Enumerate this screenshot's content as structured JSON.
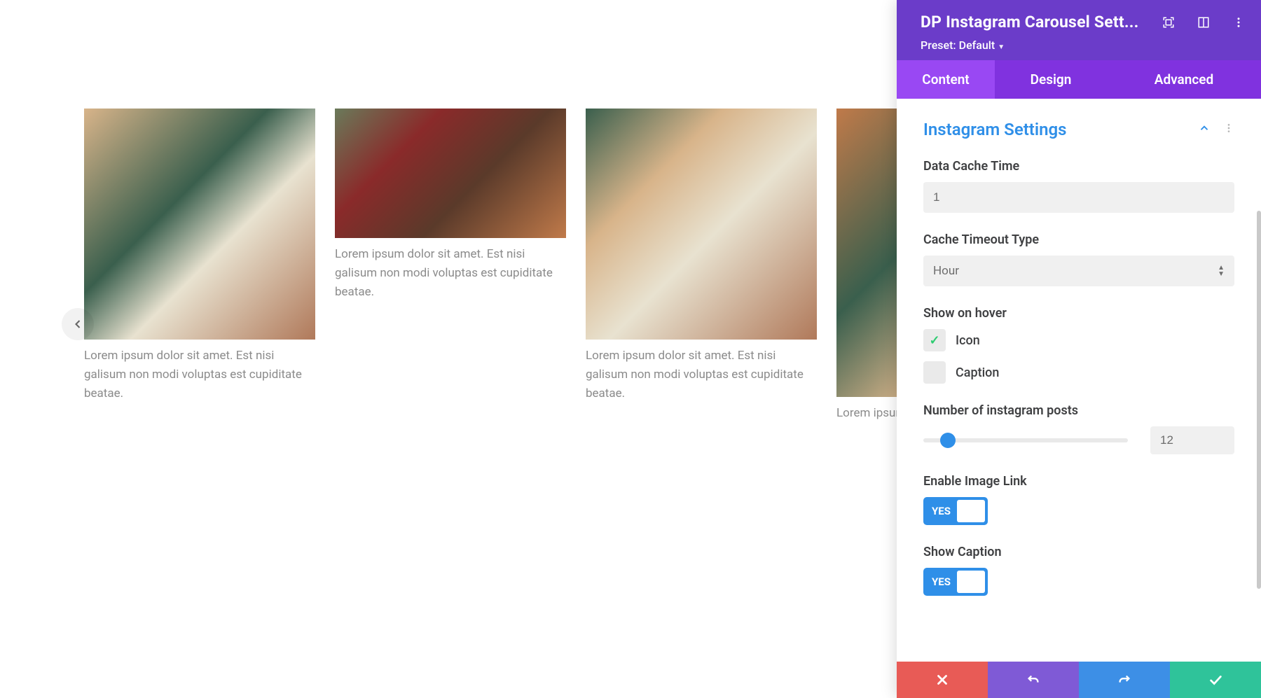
{
  "carousel": {
    "nav_prev_icon": "chevron-left",
    "items": [
      {
        "image_style": "ph1",
        "height_class": "img-tall",
        "caption": "Lorem ipsum dolor sit amet. Est nisi galisum non modi voluptas est cupiditate beatae."
      },
      {
        "image_style": "ph2",
        "height_class": "img-short",
        "caption": "Lorem ipsum dolor sit amet. Est nisi galisum non modi voluptas est cupiditate beatae."
      },
      {
        "image_style": "ph3",
        "height_class": "img-tall",
        "caption": "Lorem ipsum dolor sit amet. Est nisi galisum non modi voluptas est cupiditate beatae."
      },
      {
        "image_style": "ph4",
        "height_class": "img-large",
        "caption": "Lorem ipsum dolor sit amet. Est nisi galisum non modi voluptas est cupiditate beatae."
      }
    ]
  },
  "panel": {
    "title": "DP Instagram Carousel Sett...",
    "preset_label": "Preset: Default",
    "tabs": {
      "content": "Content",
      "design": "Design",
      "advanced": "Advanced",
      "active": "content"
    },
    "section_title": "Instagram Settings",
    "fields": {
      "data_cache_time": {
        "label": "Data Cache Time",
        "value": "1"
      },
      "cache_timeout_type": {
        "label": "Cache Timeout Type",
        "value": "Hour"
      },
      "show_on_hover": {
        "label": "Show on hover",
        "options": [
          {
            "label": "Icon",
            "checked": true
          },
          {
            "label": "Caption",
            "checked": false
          }
        ]
      },
      "num_posts": {
        "label": "Number of instagram posts",
        "value": "12",
        "percent": 12
      },
      "enable_image_link": {
        "label": "Enable Image Link",
        "value": "YES"
      },
      "show_caption": {
        "label": "Show Caption",
        "value": "YES"
      }
    },
    "footer": {
      "cancel": "cancel",
      "undo": "undo",
      "redo": "redo",
      "save": "save"
    }
  }
}
